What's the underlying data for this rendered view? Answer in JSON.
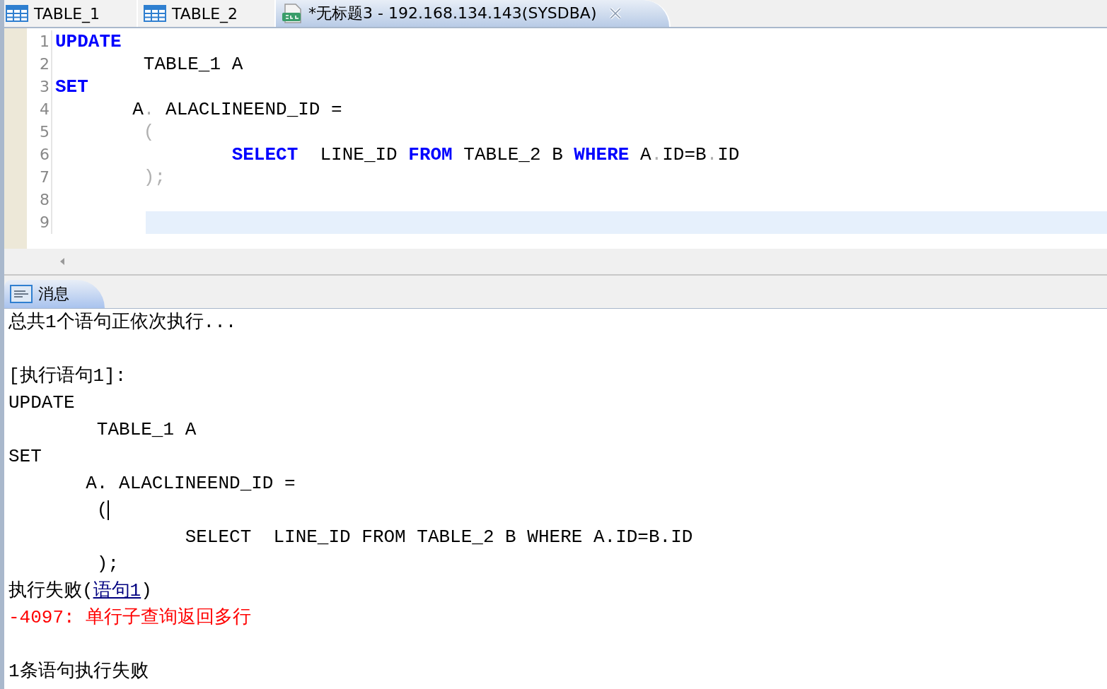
{
  "tabs": [
    {
      "kind": "table",
      "label": "TABLE_1",
      "selected": false,
      "closable": false
    },
    {
      "kind": "table",
      "label": "TABLE_2",
      "selected": false,
      "closable": false
    },
    {
      "kind": "sql",
      "label": "*无标题3 - 192.168.134.143(SYSDBA)",
      "selected": true,
      "closable": true
    }
  ],
  "editor": {
    "lines": [
      {
        "number": "1",
        "current": false,
        "tokens": [
          {
            "kind": "keyword",
            "text": "UPDATE"
          }
        ]
      },
      {
        "number": "2",
        "current": false,
        "tokens": [
          {
            "kind": "plain",
            "text": "        TABLE_1 A"
          }
        ]
      },
      {
        "number": "3",
        "current": false,
        "tokens": [
          {
            "kind": "keyword",
            "text": "SET"
          }
        ]
      },
      {
        "number": "4",
        "current": false,
        "tokens": [
          {
            "kind": "plain",
            "text": "       A"
          },
          {
            "kind": "punct",
            "text": "."
          },
          {
            "kind": "plain",
            "text": " ALACLINEEND_ID ="
          }
        ]
      },
      {
        "number": "5",
        "current": false,
        "tokens": [
          {
            "kind": "punct",
            "text": "        ("
          }
        ]
      },
      {
        "number": "6",
        "current": false,
        "tokens": [
          {
            "kind": "keyword",
            "text": "                SELECT"
          },
          {
            "kind": "plain",
            "text": "  LINE_ID "
          },
          {
            "kind": "keyword",
            "text": "FROM"
          },
          {
            "kind": "plain",
            "text": " TABLE_2 B "
          },
          {
            "kind": "keyword",
            "text": "WHERE"
          },
          {
            "kind": "plain",
            "text": " A"
          },
          {
            "kind": "punct",
            "text": "."
          },
          {
            "kind": "plain",
            "text": "ID=B"
          },
          {
            "kind": "punct",
            "text": "."
          },
          {
            "kind": "plain",
            "text": "ID"
          }
        ]
      },
      {
        "number": "7",
        "current": false,
        "tokens": [
          {
            "kind": "punct",
            "text": "        );"
          }
        ]
      },
      {
        "number": "8",
        "current": false
      },
      {
        "number": "9",
        "current": true
      }
    ]
  },
  "messages_tab": {
    "label": "消息",
    "selected": true
  },
  "messages": [
    {
      "kind": "text",
      "text": "总共1个语句正依次执行..."
    },
    {
      "kind": "blank"
    },
    {
      "kind": "text",
      "text": "[执行语句1]:"
    },
    {
      "kind": "text",
      "text": "UPDATE"
    },
    {
      "kind": "text",
      "text": "        TABLE_1 A"
    },
    {
      "kind": "text",
      "text": "SET"
    },
    {
      "kind": "text",
      "text": "       A. ALACLINEEND_ID ="
    },
    {
      "kind": "text",
      "text": "        (",
      "cursor": true
    },
    {
      "kind": "text",
      "text": "                SELECT  LINE_ID FROM TABLE_2 B WHERE A.ID=B.ID"
    },
    {
      "kind": "text",
      "text": "        );"
    },
    {
      "kind": "failure",
      "prefix": "执行失败(",
      "link": "语句1",
      "suffix": ")"
    },
    {
      "kind": "error",
      "text": "-4097: 单行子查询返回多行"
    },
    {
      "kind": "blank"
    },
    {
      "kind": "text",
      "text": "1条语句执行失败"
    }
  ]
}
